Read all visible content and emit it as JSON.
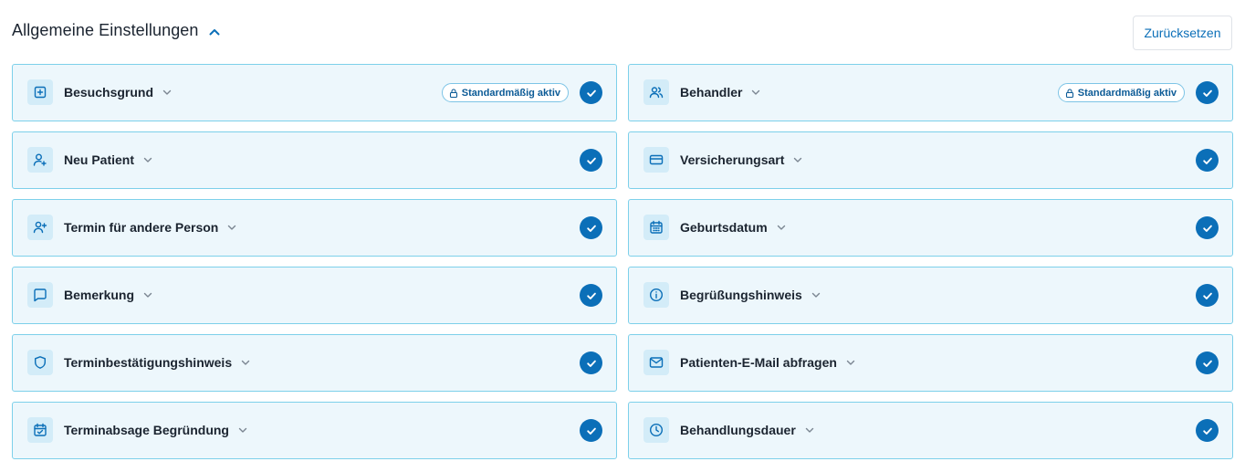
{
  "header": {
    "title": "Allgemeine Einstellungen",
    "title_icon": "chevron-up-icon",
    "reset_label": "Zurücksetzen"
  },
  "badge_label": "Standardmäßig aktiv",
  "colors": {
    "accent": "#0b6fb8",
    "card_bg": "#edf7fc",
    "card_border": "#7dd0ea",
    "icon_bg": "#d3ecf8"
  },
  "cards": [
    {
      "label": "Besuchsgrund",
      "icon": "plus-square-icon",
      "locked": true,
      "checked": true
    },
    {
      "label": "Behandler",
      "icon": "users-icon",
      "locked": true,
      "checked": true
    },
    {
      "label": "Neu Patient",
      "icon": "user-plus-icon",
      "locked": false,
      "checked": true
    },
    {
      "label": "Versicherungsart",
      "icon": "credit-card-icon",
      "locked": false,
      "checked": true
    },
    {
      "label": "Termin für andere Person",
      "icon": "user-add-icon",
      "locked": false,
      "checked": true
    },
    {
      "label": "Geburtsdatum",
      "icon": "calendar-icon",
      "locked": false,
      "checked": true
    },
    {
      "label": "Bemerkung",
      "icon": "message-icon",
      "locked": false,
      "checked": true
    },
    {
      "label": "Begrüßungshinweis",
      "icon": "info-icon",
      "locked": false,
      "checked": true
    },
    {
      "label": "Terminbestätigungshinweis",
      "icon": "shield-icon",
      "locked": false,
      "checked": true
    },
    {
      "label": "Patienten-E-Mail abfragen",
      "icon": "mail-icon",
      "locked": false,
      "checked": true
    },
    {
      "label": "Terminabsage Begründung",
      "icon": "calendar-check-icon",
      "locked": false,
      "checked": true
    },
    {
      "label": "Behandlungsdauer",
      "icon": "clock-icon",
      "locked": false,
      "checked": true
    }
  ]
}
